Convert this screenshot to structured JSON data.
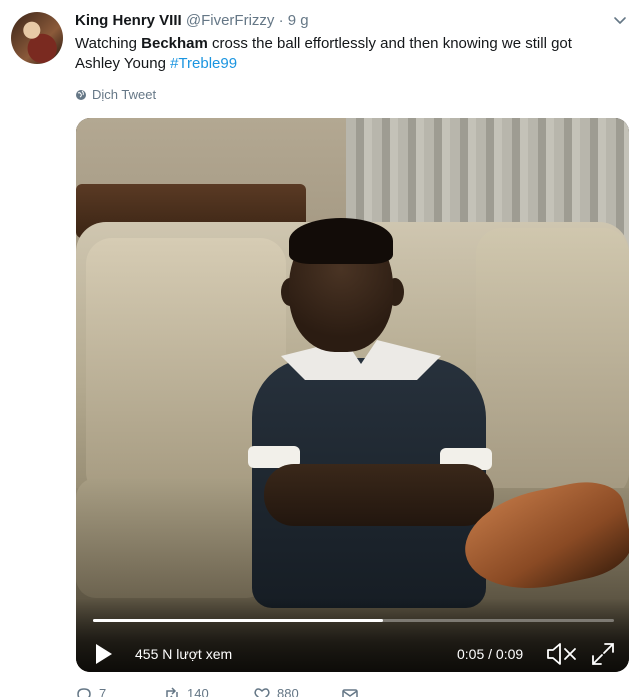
{
  "tweet": {
    "display_name": "King Henry VIII",
    "handle": "@FiverFrizzy",
    "separator": "·",
    "time": "9 g",
    "text_part1": "Watching ",
    "text_bold": "Beckham",
    "text_part2": " cross the ball effortlessly and then knowing we still got Ashley Young ",
    "hashtag": "#Treble99",
    "translate_label": "Dịch Tweet"
  },
  "video": {
    "views": "455 N lượt xem",
    "timecode": "0:05 / 0:09",
    "progress_fraction": 0.556
  },
  "actions": {
    "reply_count": "7",
    "retweet_count": "140",
    "like_count": "880"
  },
  "colors": {
    "text": "#14171a",
    "secondary": "#657786",
    "link": "#1b95e0"
  }
}
